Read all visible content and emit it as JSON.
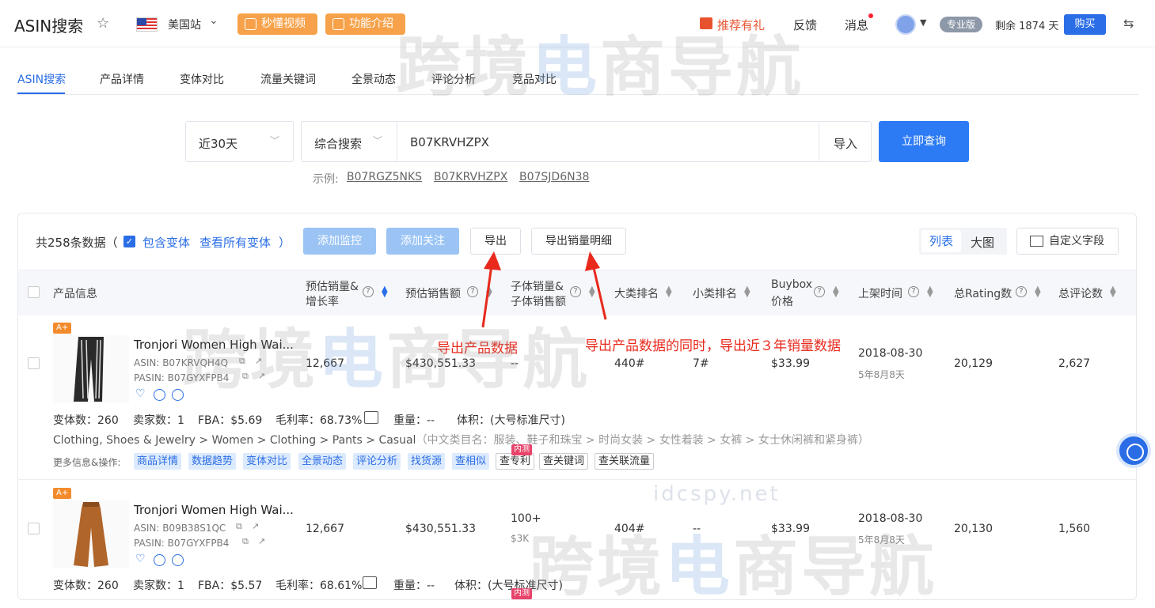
{
  "header": {
    "title": "ASIN搜索",
    "site": "美国站",
    "video_btn": "秒懂视频",
    "intro_btn": "功能介绍",
    "gift": "推荐有礼",
    "feedback": "反馈",
    "messages": "消息",
    "plan_badge": "专业版",
    "remaining": "剩余 1874 天",
    "buy": "购买"
  },
  "tabs": [
    "ASIN搜索",
    "产品详情",
    "变体对比",
    "流量关键词",
    "全景动态",
    "评论分析",
    "竞品对比"
  ],
  "search": {
    "period": "近30天",
    "mode": "综合搜索",
    "value": "B07KRVHZPX",
    "import": "导入",
    "submit": "立即查询",
    "examples_label": "示例:",
    "examples": [
      "B07RGZ5NKS",
      "B07KRVHZPX",
      "B07SJD6N38"
    ]
  },
  "toolbar": {
    "count": "共258条数据（",
    "include_variants": "包含变体",
    "view_all": "查看所有变体",
    "close_paren": "）",
    "add_monitor": "添加监控",
    "add_follow": "添加关注",
    "export": "导出",
    "export_sales": "导出销量明细",
    "view_list": "列表",
    "view_big": "大图",
    "custom_fields": "自定义字段"
  },
  "columns": {
    "product": "产品信息",
    "est_sales_1": "预估销量&",
    "est_sales_2": "增长率",
    "est_revenue": "预估销售额",
    "child_1": "子体销量&",
    "child_2": "子体销售额",
    "main_rank": "大类排名",
    "sub_rank": "小类排名",
    "buybox_1": "Buybox",
    "buybox_2": "价格",
    "listed": "上架时间",
    "ratings": "总Rating数",
    "reviews": "总评论数"
  },
  "annotations": {
    "export_note": "导出产品数据",
    "export_sales_note": "导出产品数据的同时，导出近３年销量数据"
  },
  "rows": [
    {
      "badge": "A+",
      "title": "Tronjori Women High Wai...",
      "asin": "ASIN: B07KRVQH4Q",
      "pasin": "PASIN: B07GYXFPB4",
      "sales": "12,667",
      "revenue": "$430,551.33",
      "child": "--",
      "child_sub": "",
      "main_rank": "440#",
      "sub_rank": "7#",
      "price": "$33.99",
      "date": "2018-08-30",
      "age": "5年8月8天",
      "ratings": "20,129",
      "reviews": "2,627",
      "variants": "变体数：260",
      "sellers": "卖家数：1",
      "fba": "FBA：$5.69",
      "margin": "毛利率：68.73%",
      "weight": "重量：--",
      "volume": "体积：(大号标准尺寸)",
      "category_en": "Clothing, Shoes & Jewelry > Women > Clothing > Pants > Casual",
      "category_cn": "（中文类目名：服装、鞋子和珠宝 > 时尚女装 > 女性着装 > 女裤 > 女士休闲裤和紧身裤）",
      "more_label": "更多信息&操作:",
      "blue_tags": [
        "商品详情",
        "数据趋势",
        "变体对比",
        "全景动态",
        "评论分析",
        "找货源",
        "查相似"
      ],
      "white_tags": [
        "查专利",
        "查关键词",
        "查关联流量"
      ],
      "inner_test": "内测"
    },
    {
      "badge": "A+",
      "title": "Tronjori Women High Wai...",
      "asin": "ASIN: B09B38S1QC",
      "pasin": "PASIN: B07GYXFPB4",
      "sales": "12,667",
      "revenue": "$430,551.33",
      "child": "100+",
      "child_sub": "$3K",
      "main_rank": "404#",
      "sub_rank": "--",
      "price": "$33.99",
      "date": "2018-08-30",
      "age": "5年8月8天",
      "ratings": "20,130",
      "reviews": "1,560",
      "variants": "变体数：260",
      "sellers": "卖家数：1",
      "fba": "FBA：$5.57",
      "margin": "毛利率：68.61%",
      "weight": "重量：--",
      "volume": "体积：(大号标准尺寸)",
      "inner_test": "内测"
    }
  ],
  "watermark": {
    "text_a": "跨境",
    "text_b": "电",
    "text_c": "商导航",
    "url": "idcspy.net"
  },
  "colors": {
    "accent": "#2a6de6",
    "orange": "#f7a24a",
    "annotation": "#e8291c"
  }
}
